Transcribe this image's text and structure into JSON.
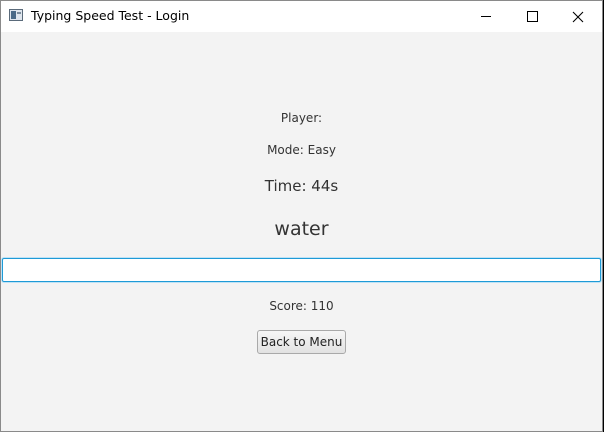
{
  "window": {
    "title": "Typing Speed Test - Login",
    "icons": {
      "app": "app-icon",
      "minimize": "minimize-icon",
      "maximize": "maximize-icon",
      "close": "close-icon"
    },
    "close_glyph": "✕"
  },
  "game": {
    "player_label": "Player:",
    "mode_label": "Mode: Easy",
    "time_label": "Time: 44s",
    "current_word": "water",
    "input_value": "",
    "score_label": "Score: 110",
    "back_button_label": "Back to Menu"
  },
  "colors": {
    "accent": "#1e9ad6",
    "background": "#f3f3f3",
    "titlebar": "#ffffff"
  }
}
